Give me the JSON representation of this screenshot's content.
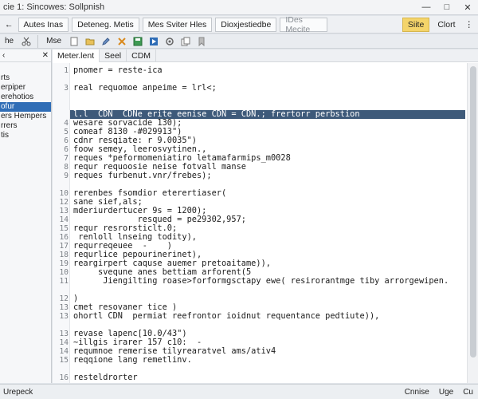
{
  "titlebar": {
    "title": "cie 1:  Sincowes: Sollpnish",
    "controls": [
      "—",
      "□",
      "✕"
    ]
  },
  "toolbar": {
    "back": "←",
    "items": [
      "Autes Inas",
      "Deteneg. Metis",
      "Mes Sviter Hles",
      "Dioxjestiedbe"
    ],
    "search_placeholder": "IDes Mecite",
    "right_yellow": "Siite",
    "right_btn": "Clort",
    "right_icon": "⋮"
  },
  "toolbar2": {
    "left_label": "he",
    "mid_label": "Mse"
  },
  "sidebar": {
    "items": [
      "rts",
      "erpiper",
      "erehotios",
      "ofur",
      "ers Hempers",
      "rrers",
      "tis"
    ],
    "selected_index": 3
  },
  "editor": {
    "tabs": [
      "Meter.lent",
      "Seel",
      "CDM"
    ],
    "highlight_line_index": 3,
    "lines": [
      {
        "n": "1",
        "t": "pnomer = reste-ica"
      },
      {
        "n": "",
        "t": ""
      },
      {
        "n": "3",
        "t": "real requomoe anpeime = lrl<;"
      },
      {
        "n": "",
        "t": ""
      },
      {
        "n": "",
        "t": ""
      },
      {
        "n": "",
        "t": "l.l  CDN  CDNe erite eenise CDN = CDN.; frertorr perbstion"
      },
      {
        "n": "4",
        "t": "wesare sorvacide 130);"
      },
      {
        "n": "5",
        "t": "comeaf 8130 -#029913\")"
      },
      {
        "n": "6",
        "t": "cdnr resqiate: r 9.0035\")"
      },
      {
        "n": "6",
        "t": "foow semey, leerosvytinen.,"
      },
      {
        "n": "7",
        "t": "reques *peformomeniatiro letamafarmips_m0028"
      },
      {
        "n": "8",
        "t": "requr requoosie neise fotvall manse"
      },
      {
        "n": "9",
        "t": "reques furbenut.vnr/frebes);"
      },
      {
        "n": "",
        "t": ""
      },
      {
        "n": "10",
        "t": "rerenbes fsomdior eterertiaser("
      },
      {
        "n": "12",
        "t": "sane sief,als;"
      },
      {
        "n": "13",
        "t": "mderiurdertucer 9s = 1200);"
      },
      {
        "n": "14",
        "t": "             resqued = pe29302,957;"
      },
      {
        "n": "15",
        "t": "requr resrorsticlt.0;"
      },
      {
        "n": "16",
        "t": " renloll lnseing todity),"
      },
      {
        "n": "17",
        "t": "requrreqeuee  -    )"
      },
      {
        "n": "18",
        "t": "requrlice pepourinerinet),"
      },
      {
        "n": "19",
        "t": "reargirpert caquse auemer pretoaitame)),"
      },
      {
        "n": "10",
        "t": "     svequne anes bettiam arforent(5"
      },
      {
        "n": "11",
        "t": "      Jiengilting roase>forformgsctapy ewe( resirorantmge tiby arrorgewipen."
      },
      {
        "n": "",
        "t": ""
      },
      {
        "n": "12",
        "t": ")"
      },
      {
        "n": "13",
        "t": "cmet resovaner tice )"
      },
      {
        "n": "13",
        "t": "ohortl CDN  permiat reefrontor ioidnut requentance pedtiute)),"
      },
      {
        "n": "",
        "t": ""
      },
      {
        "n": "13",
        "t": "revase lapenc[10.0/43\")"
      },
      {
        "n": "14",
        "t": "~illgis irarer 157 c10:  -"
      },
      {
        "n": "14",
        "t": "requmnoe remerise tilyrearatvel ams/ativ4"
      },
      {
        "n": "15",
        "t": "reqqione lang remetlinv."
      },
      {
        "n": "",
        "t": ""
      },
      {
        "n": "16",
        "t": "resteldrorter"
      }
    ]
  },
  "statusbar": {
    "left": "Urepeck",
    "right_items": [
      "Cnnise",
      "Uge",
      "Cu"
    ]
  },
  "colors": {
    "selection": "#2f6db6",
    "highlight_line": "#3e5a7a",
    "accent_yellow": "#f4d46a"
  }
}
